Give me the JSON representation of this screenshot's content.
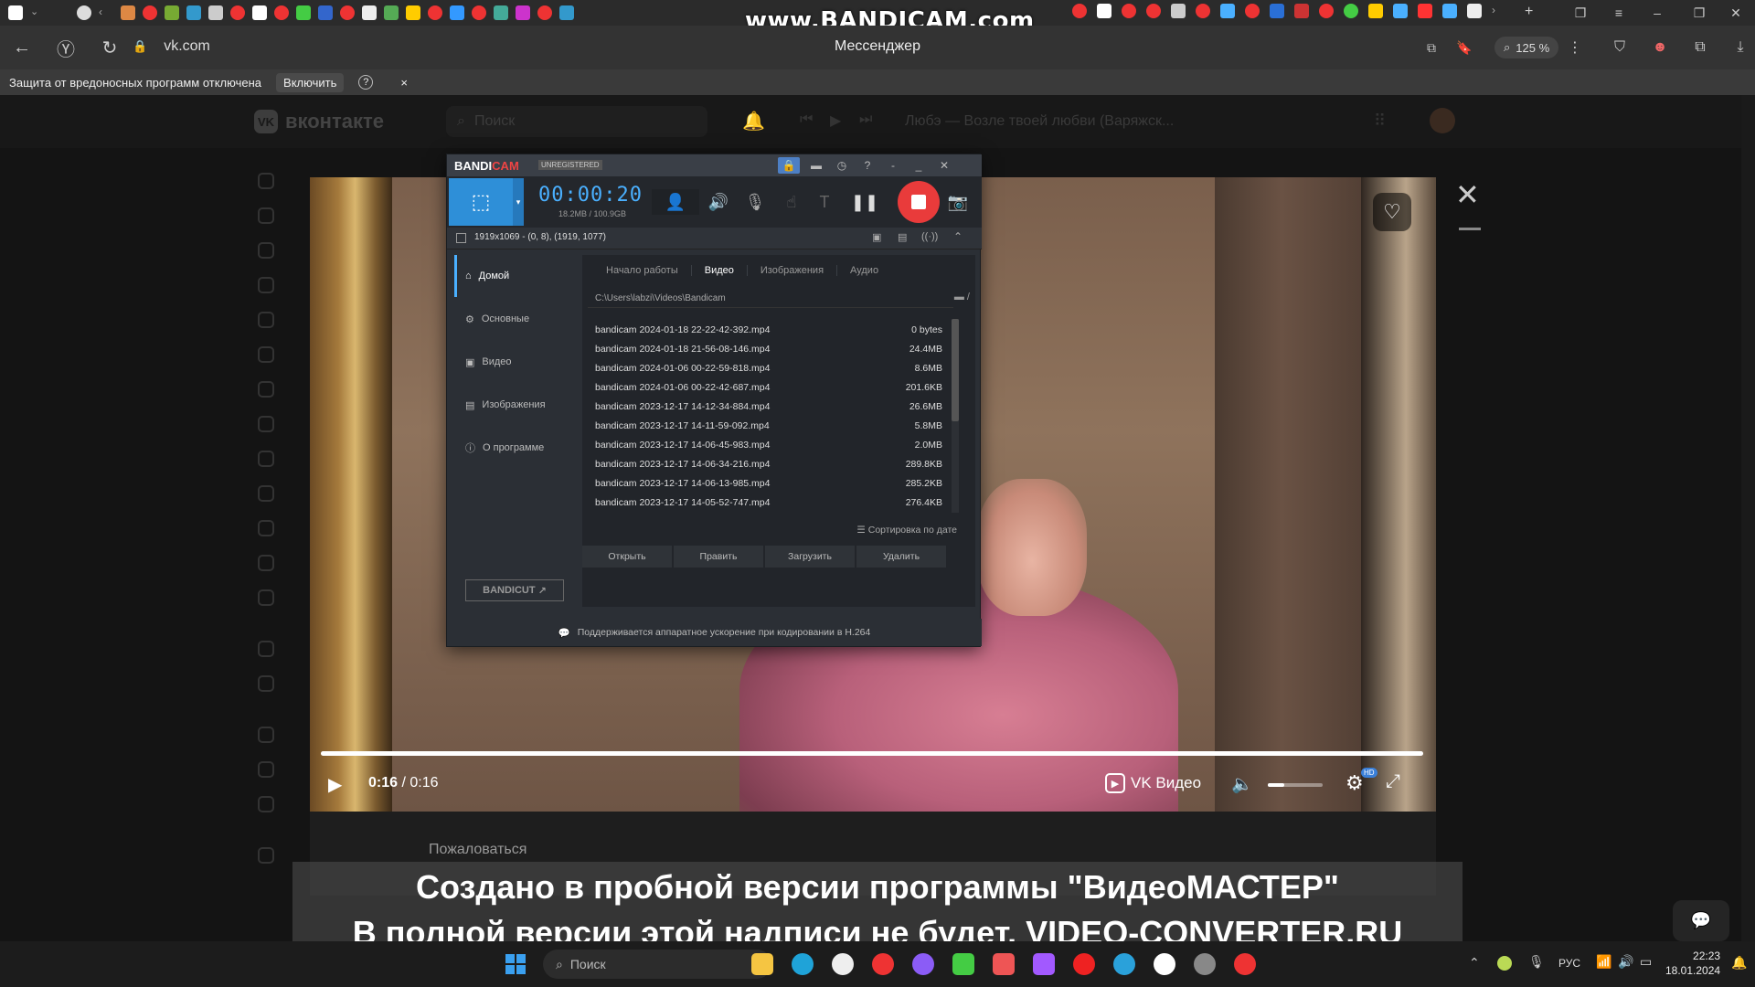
{
  "browser": {
    "watermark": "www.BANDICAM.com",
    "url": "vk.com",
    "page_title": "Мессенджер",
    "zoom": "125 %",
    "protection_text": "Защита от вредоносных программ отключена",
    "protection_enable": "Включить",
    "protection_help": "?",
    "protection_close": "×"
  },
  "vk": {
    "logo": "вконтакте",
    "search_placeholder": "Поиск",
    "track": "Любэ — Возле твоей любви (Варяжск..."
  },
  "player": {
    "time_current": "0:16",
    "time_sep": " / ",
    "time_total": "0:16",
    "progress": 1.0,
    "volume": 0.3,
    "brand": "VK Видео",
    "hd": "HD",
    "report": "Пожаловаться"
  },
  "bandicam": {
    "brand_a": "BANDI",
    "brand_b": "CAM",
    "unregistered": "UNREGISTERED",
    "timer": "00:00:20",
    "size": "18.2MB / 100.9GB",
    "area": "1919x1069 - (0, 8), (1919, 1077)",
    "nav": [
      "Домой",
      "Основные",
      "Видео",
      "Изображения",
      "О программе"
    ],
    "tabs": [
      "Начало работы",
      "Видео",
      "Изображения",
      "Аудио"
    ],
    "path": "C:\\Users\\labzi\\Videos\\Bandicam",
    "files": [
      {
        "name": "bandicam 2024-01-18 22-22-42-392.mp4",
        "size": "0 bytes"
      },
      {
        "name": "bandicam 2024-01-18 21-56-08-146.mp4",
        "size": "24.4MB"
      },
      {
        "name": "bandicam 2024-01-06 00-22-59-818.mp4",
        "size": "8.6MB"
      },
      {
        "name": "bandicam 2024-01-06 00-22-42-687.mp4",
        "size": "201.6KB"
      },
      {
        "name": "bandicam 2023-12-17 14-12-34-884.mp4",
        "size": "26.6MB"
      },
      {
        "name": "bandicam 2023-12-17 14-11-59-092.mp4",
        "size": "5.8MB"
      },
      {
        "name": "bandicam 2023-12-17 14-06-45-983.mp4",
        "size": "2.0MB"
      },
      {
        "name": "bandicam 2023-12-17 14-06-34-216.mp4",
        "size": "289.8KB"
      },
      {
        "name": "bandicam 2023-12-17 14-06-13-985.mp4",
        "size": "285.2KB"
      },
      {
        "name": "bandicam 2023-12-17 14-05-52-747.mp4",
        "size": "276.4KB"
      }
    ],
    "sort": "Сортировка по дате",
    "actions": [
      "Открыть",
      "Править",
      "Загрузить",
      "Удалить"
    ],
    "bandicut": "BANDICUT",
    "status": "Поддерживается аппаратное ускорение при кодировании в H.264"
  },
  "overlay": {
    "line1": "Создано в пробной версии программы \"ВидеоМАСТЕР\"",
    "line2": "В полной версии этой надписи не будет. VIDEO-CONVERTER.RU"
  },
  "taskbar": {
    "search": "Поиск",
    "lang": "РУС",
    "time": "22:23",
    "date": "18.01.2024"
  }
}
